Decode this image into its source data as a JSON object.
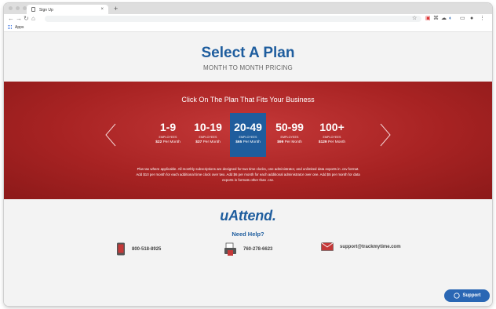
{
  "browser": {
    "tab_title": "Sign Up",
    "tab_close": "×",
    "new_tab": "+",
    "bookmarks_apps_label": "Apps"
  },
  "hero": {
    "title": "Select A Plan",
    "subtitle": "MONTH TO MONTH PRICING"
  },
  "plans_section": {
    "heading": "Click On The Plan That Fits Your Business",
    "plans": [
      {
        "range": "1-9",
        "employees_label": "EMPLOYEES",
        "price": "$22",
        "period": "Per Month",
        "selected": false
      },
      {
        "range": "10-19",
        "employees_label": "EMPLOYEES",
        "price": "$37",
        "period": "Per Month",
        "selected": false
      },
      {
        "range": "20-49",
        "employees_label": "EMPLOYEES",
        "price": "$65",
        "period": "Per Month",
        "selected": true
      },
      {
        "range": "50-99",
        "employees_label": "EMPLOYEES",
        "price": "$99",
        "period": "Per Month",
        "selected": false
      },
      {
        "range": "100+",
        "employees_label": "EMPLOYEES",
        "price": "$129",
        "period": "Per Month",
        "selected": false
      }
    ],
    "fine_print": "Plus tax where applicable. All monthly subscriptions are designed for two time clocks, one administrator, and unlimited data exports in .csv format. Add $10 per month for each additional time clock over two. Add $6 per month for each additional administrator over one. Add $5 per month for data exports in formats other than .csv."
  },
  "footer": {
    "logo_text": "uAttend.",
    "need_help": "Need Help?",
    "contacts": [
      {
        "icon": "mobile-phone-icon",
        "text": "800-518-8925"
      },
      {
        "icon": "fax-icon",
        "text": "760-278-6623"
      },
      {
        "icon": "envelope-icon",
        "text": "support@trackmytime.com"
      }
    ],
    "support_button": "Support"
  },
  "colors": {
    "brand_blue": "#1e5d9e",
    "band_red": "#a82323",
    "selected_plan": "#1f5d9d"
  }
}
